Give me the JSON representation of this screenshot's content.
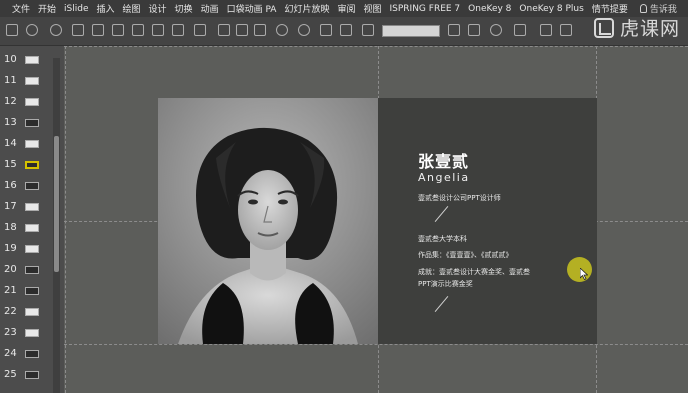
{
  "menubar": {
    "items": [
      "文件",
      "开始",
      "iSlide",
      "插入",
      "绘图",
      "设计",
      "切换",
      "动画",
      "口袋动画 PA",
      "幻灯片放映",
      "审阅",
      "视图",
      "ISPRING FREE 7",
      "OneKey 8",
      "OneKey 8 Plus",
      "情节提要"
    ],
    "tell_me": "告诉我"
  },
  "watermark": "虎课网",
  "thumbnails": [
    {
      "number": "10",
      "style": "light"
    },
    {
      "number": "11",
      "style": "light"
    },
    {
      "number": "12",
      "style": "light"
    },
    {
      "number": "13",
      "style": "dark"
    },
    {
      "number": "14",
      "style": "light"
    },
    {
      "number": "15",
      "style": "dark",
      "active": true
    },
    {
      "number": "16",
      "style": "dark"
    },
    {
      "number": "17",
      "style": "light"
    },
    {
      "number": "18",
      "style": "light"
    },
    {
      "number": "19",
      "style": "light"
    },
    {
      "number": "20",
      "style": "dark"
    },
    {
      "number": "21",
      "style": "dark"
    },
    {
      "number": "22",
      "style": "light"
    },
    {
      "number": "23",
      "style": "light"
    },
    {
      "number": "24",
      "style": "dark"
    },
    {
      "number": "25",
      "style": "dark"
    }
  ],
  "slide": {
    "name": "张壹贰",
    "english_name": "Angelia",
    "title_line": "壹贰叁设计公司PPT设计师",
    "education": "壹贰叁大学本科",
    "works": "作品集：《壹壹壹》、《贰贰贰》",
    "achievement_1": "成就：壹贰叁设计大赛金奖、壹贰叁",
    "achievement_2": "PPT演示比赛金奖"
  },
  "colors": {
    "menubar_bg": "#3a3a3a",
    "canvas_bg": "#5c5d5a",
    "slide_bg": "#3e3f3d",
    "cursor_halo": "#c9c41f",
    "active_thumb": "#d5c200"
  }
}
